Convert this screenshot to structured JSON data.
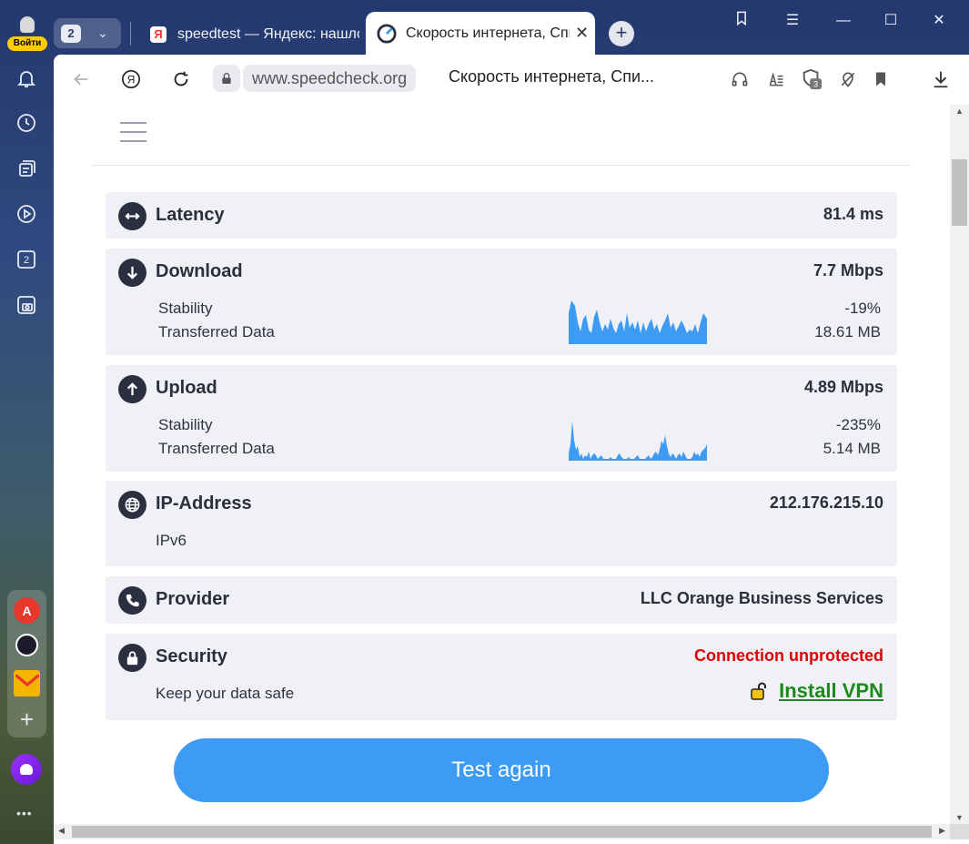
{
  "sidebar": {
    "login_label": "Войти",
    "counter": "2",
    "icons": [
      "bell-icon",
      "history-icon",
      "collections-icon",
      "video-icon",
      "tab-counter-icon",
      "screenshot-icon"
    ],
    "apps": [
      "translate-app-icon",
      "music-app-icon",
      "mail-app-icon",
      "add-app-icon"
    ],
    "more": "•••"
  },
  "tabs": {
    "counter": "2",
    "inactive_title": "speedtest — Яндекс: нашлось",
    "active_title": "Скорость интернета, Спидтест",
    "new_tab": "+"
  },
  "toolbar": {
    "domain": "www.speedcheck.org",
    "page_title": "Скорость интернета, Спи...",
    "badge_count": "3"
  },
  "results": {
    "latency": {
      "label": "Latency",
      "value": "81.4 ms"
    },
    "download": {
      "label": "Download",
      "value": "7.7 Mbps",
      "stability_label": "Stability",
      "stability_value": "-19%",
      "transferred_label": "Transferred Data",
      "transferred_value": "18.61 MB"
    },
    "upload": {
      "label": "Upload",
      "value": "4.89 Mbps",
      "stability_label": "Stability",
      "stability_value": "-235%",
      "transferred_label": "Transferred Data",
      "transferred_value": "5.14 MB"
    },
    "ip": {
      "label": "IP-Address",
      "value": "212.176.215.10",
      "version": "IPv6"
    },
    "provider": {
      "label": "Provider",
      "value": "LLC Orange Business Services"
    },
    "security": {
      "label": "Security",
      "status": "Connection unprotected",
      "note": "Keep your data safe",
      "vpn_label": "Install VPN"
    },
    "test_again": "Test again"
  },
  "colors": {
    "accent": "#3d9bf4",
    "chart": "#3d9bf4",
    "danger": "#e00000",
    "vpn": "#1a8a1a",
    "card": "#f0f1f6"
  }
}
